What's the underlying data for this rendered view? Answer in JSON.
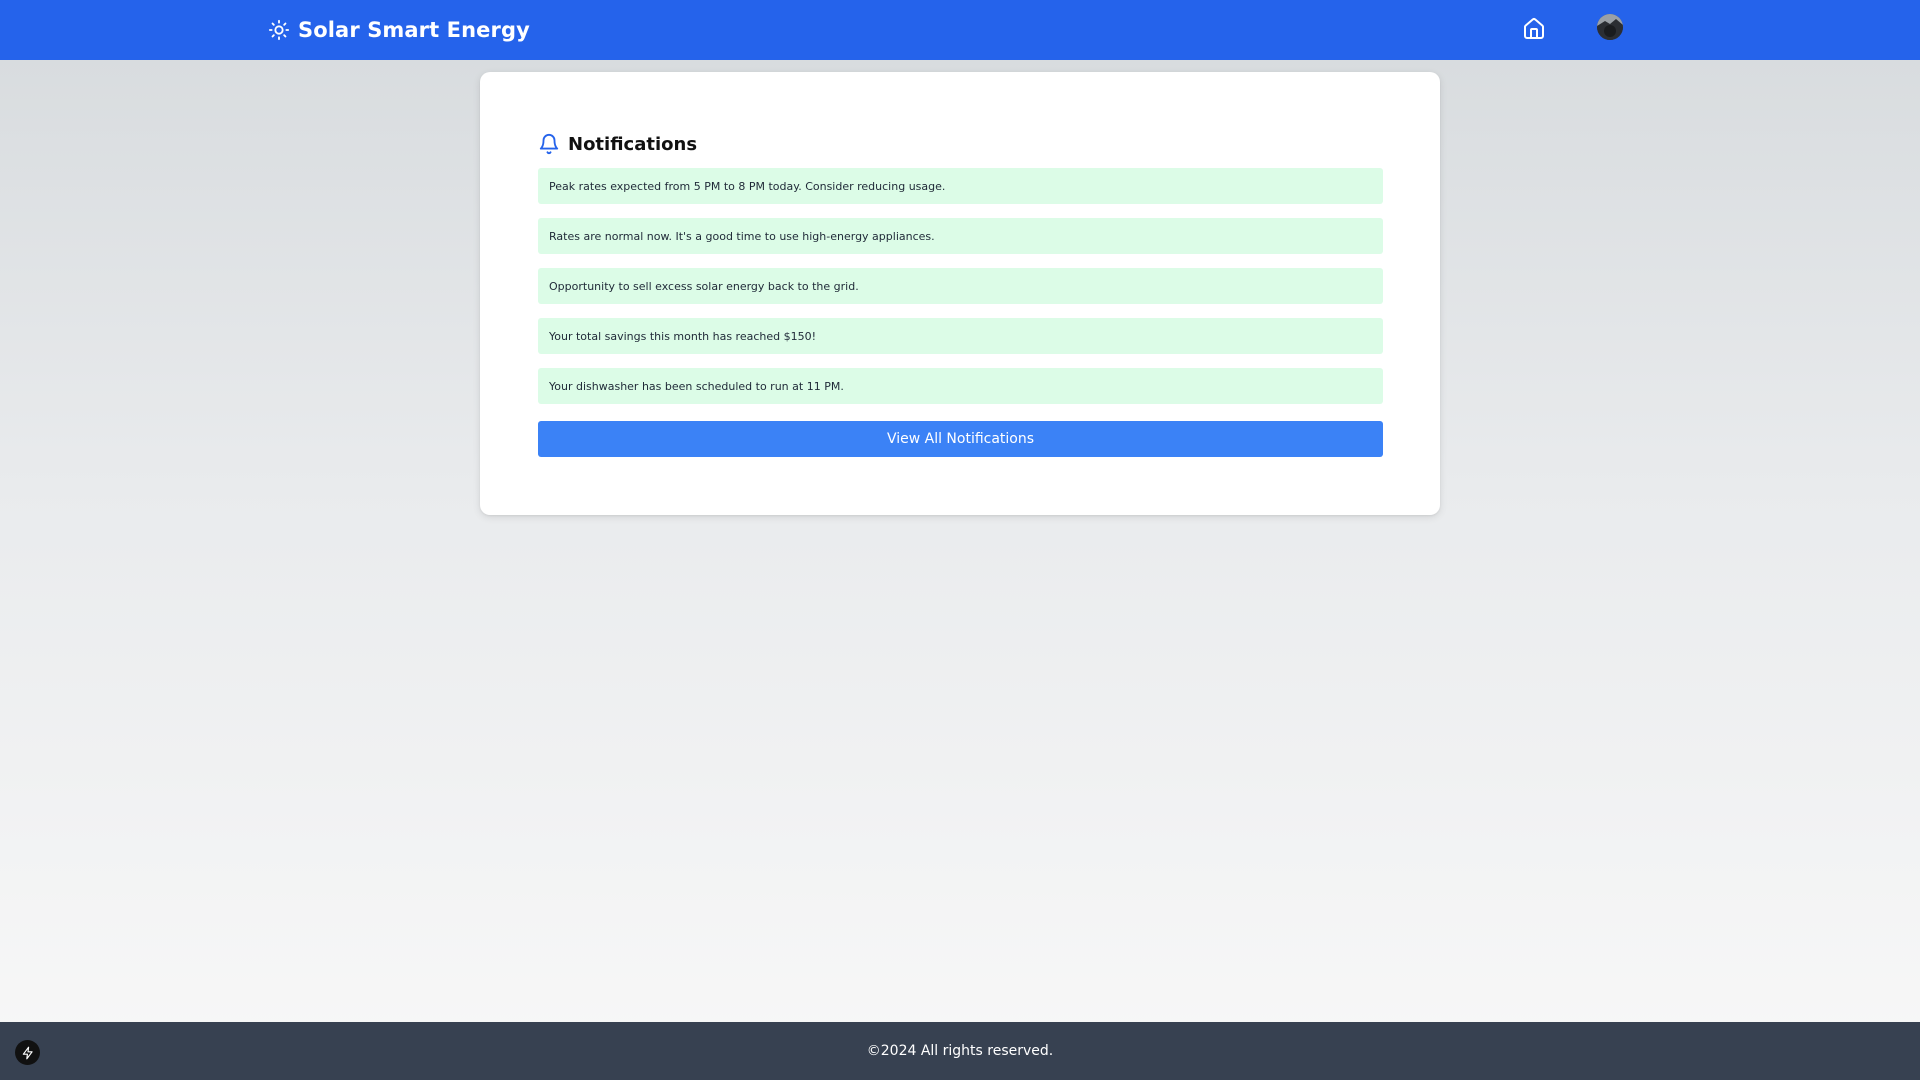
{
  "header": {
    "brand_icon": "sun-icon",
    "title": "Solar Smart Energy",
    "home_icon": "home-icon",
    "avatar": "user-avatar"
  },
  "notifications": {
    "icon": "bell-icon",
    "title": "Notifications",
    "items": [
      "Peak rates expected from 5 PM to 8 PM today. Consider reducing usage.",
      "Rates are normal now. It's a good time to use high-energy appliances.",
      "Opportunity to sell excess solar energy back to the grid.",
      "Your total savings this month has reached $150!",
      "Your dishwasher has been scheduled to run at 11 PM."
    ],
    "view_all_label": "View All Notifications"
  },
  "footer": {
    "text": "©2024 All rights reserved.",
    "badge_icon": "bolt-icon"
  },
  "colors": {
    "header_bg": "#2563eb",
    "notification_bg": "#dcfce7",
    "button_bg": "#3b82f6",
    "footer_bg": "#374151"
  }
}
